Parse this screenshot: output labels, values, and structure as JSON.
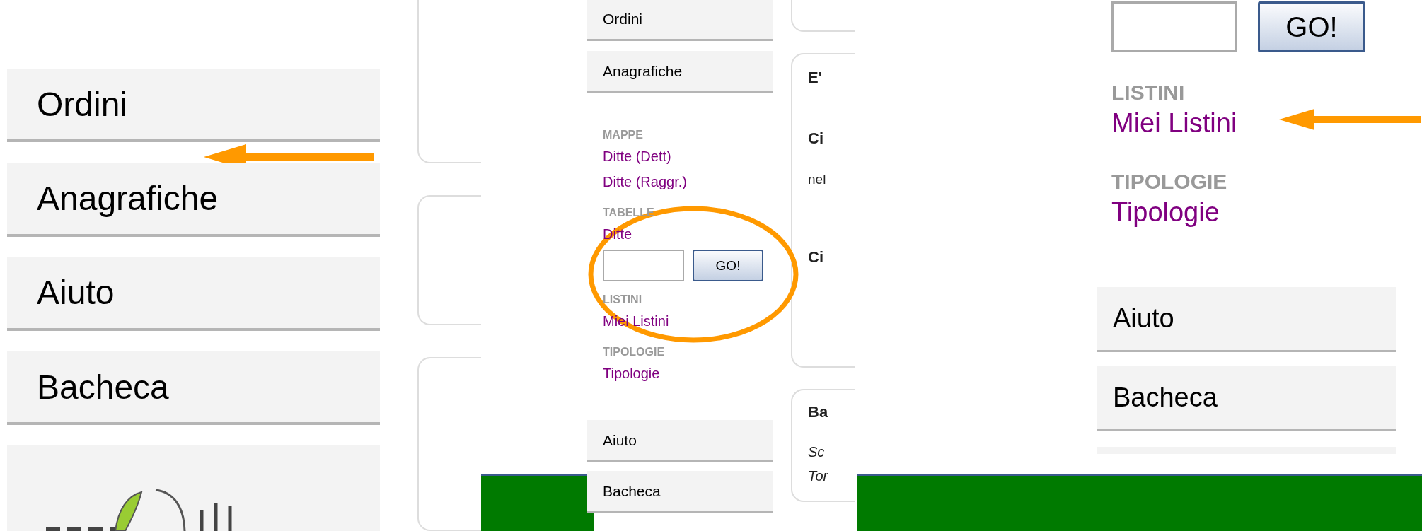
{
  "panels": [
    {
      "kind": "large",
      "annotation": {
        "kind": "arrow"
      },
      "footer_bar": false,
      "blocks": [
        {
          "kind": "menu",
          "label": "Ordini"
        },
        {
          "kind": "menu",
          "label": "Anagrafiche"
        },
        {
          "kind": "menu",
          "label": "Aiuto"
        },
        {
          "kind": "menu",
          "label": "Bacheca"
        },
        {
          "kind": "logo"
        }
      ],
      "cards": [
        {
          "kind": "frame"
        },
        {
          "kind": "frame"
        },
        {
          "kind": "frame"
        }
      ]
    },
    {
      "kind": "small",
      "annotation": {
        "kind": "ellipse"
      },
      "footer_bar": true,
      "blocks": [
        {
          "kind": "menu",
          "label": "Ordini"
        },
        {
          "kind": "menu",
          "label": "Anagrafiche"
        },
        {
          "kind": "heading",
          "label": "MAPPE"
        },
        {
          "kind": "link",
          "label": "Ditte (Dett)"
        },
        {
          "kind": "link",
          "label": "Ditte (Raggr.)"
        },
        {
          "kind": "heading",
          "label": "TABELLE"
        },
        {
          "kind": "link",
          "label": "Ditte"
        },
        {
          "kind": "search",
          "button": "GO!"
        },
        {
          "kind": "heading",
          "label": "LISTINI"
        },
        {
          "kind": "link",
          "label": "Miei Listini"
        },
        {
          "kind": "heading",
          "label": "TIPOLOGIE"
        },
        {
          "kind": "link",
          "label": "Tipologie"
        },
        {
          "kind": "menu",
          "label": "Aiuto"
        },
        {
          "kind": "menu",
          "label": "Bacheca"
        }
      ],
      "cards": [
        {
          "kind": "frame"
        },
        {
          "kind": "frame",
          "texts": [
            {
              "kind": "title",
              "text": "E'"
            },
            {
              "kind": "title",
              "text": "Ci"
            },
            {
              "kind": "body",
              "text": "nel"
            },
            {
              "kind": "title",
              "text": "Ci"
            }
          ]
        },
        {
          "kind": "frame",
          "texts": [
            {
              "kind": "title",
              "text": "Ba"
            },
            {
              "kind": "note",
              "text": "Sc"
            },
            {
              "kind": "note",
              "text": "Tor"
            }
          ]
        }
      ]
    },
    {
      "kind": "medium",
      "annotation": {
        "kind": "arrow"
      },
      "footer_bar": true,
      "blocks": [
        {
          "kind": "search",
          "button": "GO!"
        },
        {
          "kind": "heading",
          "label": "LISTINI"
        },
        {
          "kind": "link",
          "label": "Miei Listini"
        },
        {
          "kind": "heading",
          "label": "TIPOLOGIE"
        },
        {
          "kind": "link",
          "label": "Tipologie"
        },
        {
          "kind": "menu",
          "label": "Aiuto"
        },
        {
          "kind": "menu",
          "label": "Bacheca"
        },
        {
          "kind": "edge"
        }
      ]
    }
  ]
}
